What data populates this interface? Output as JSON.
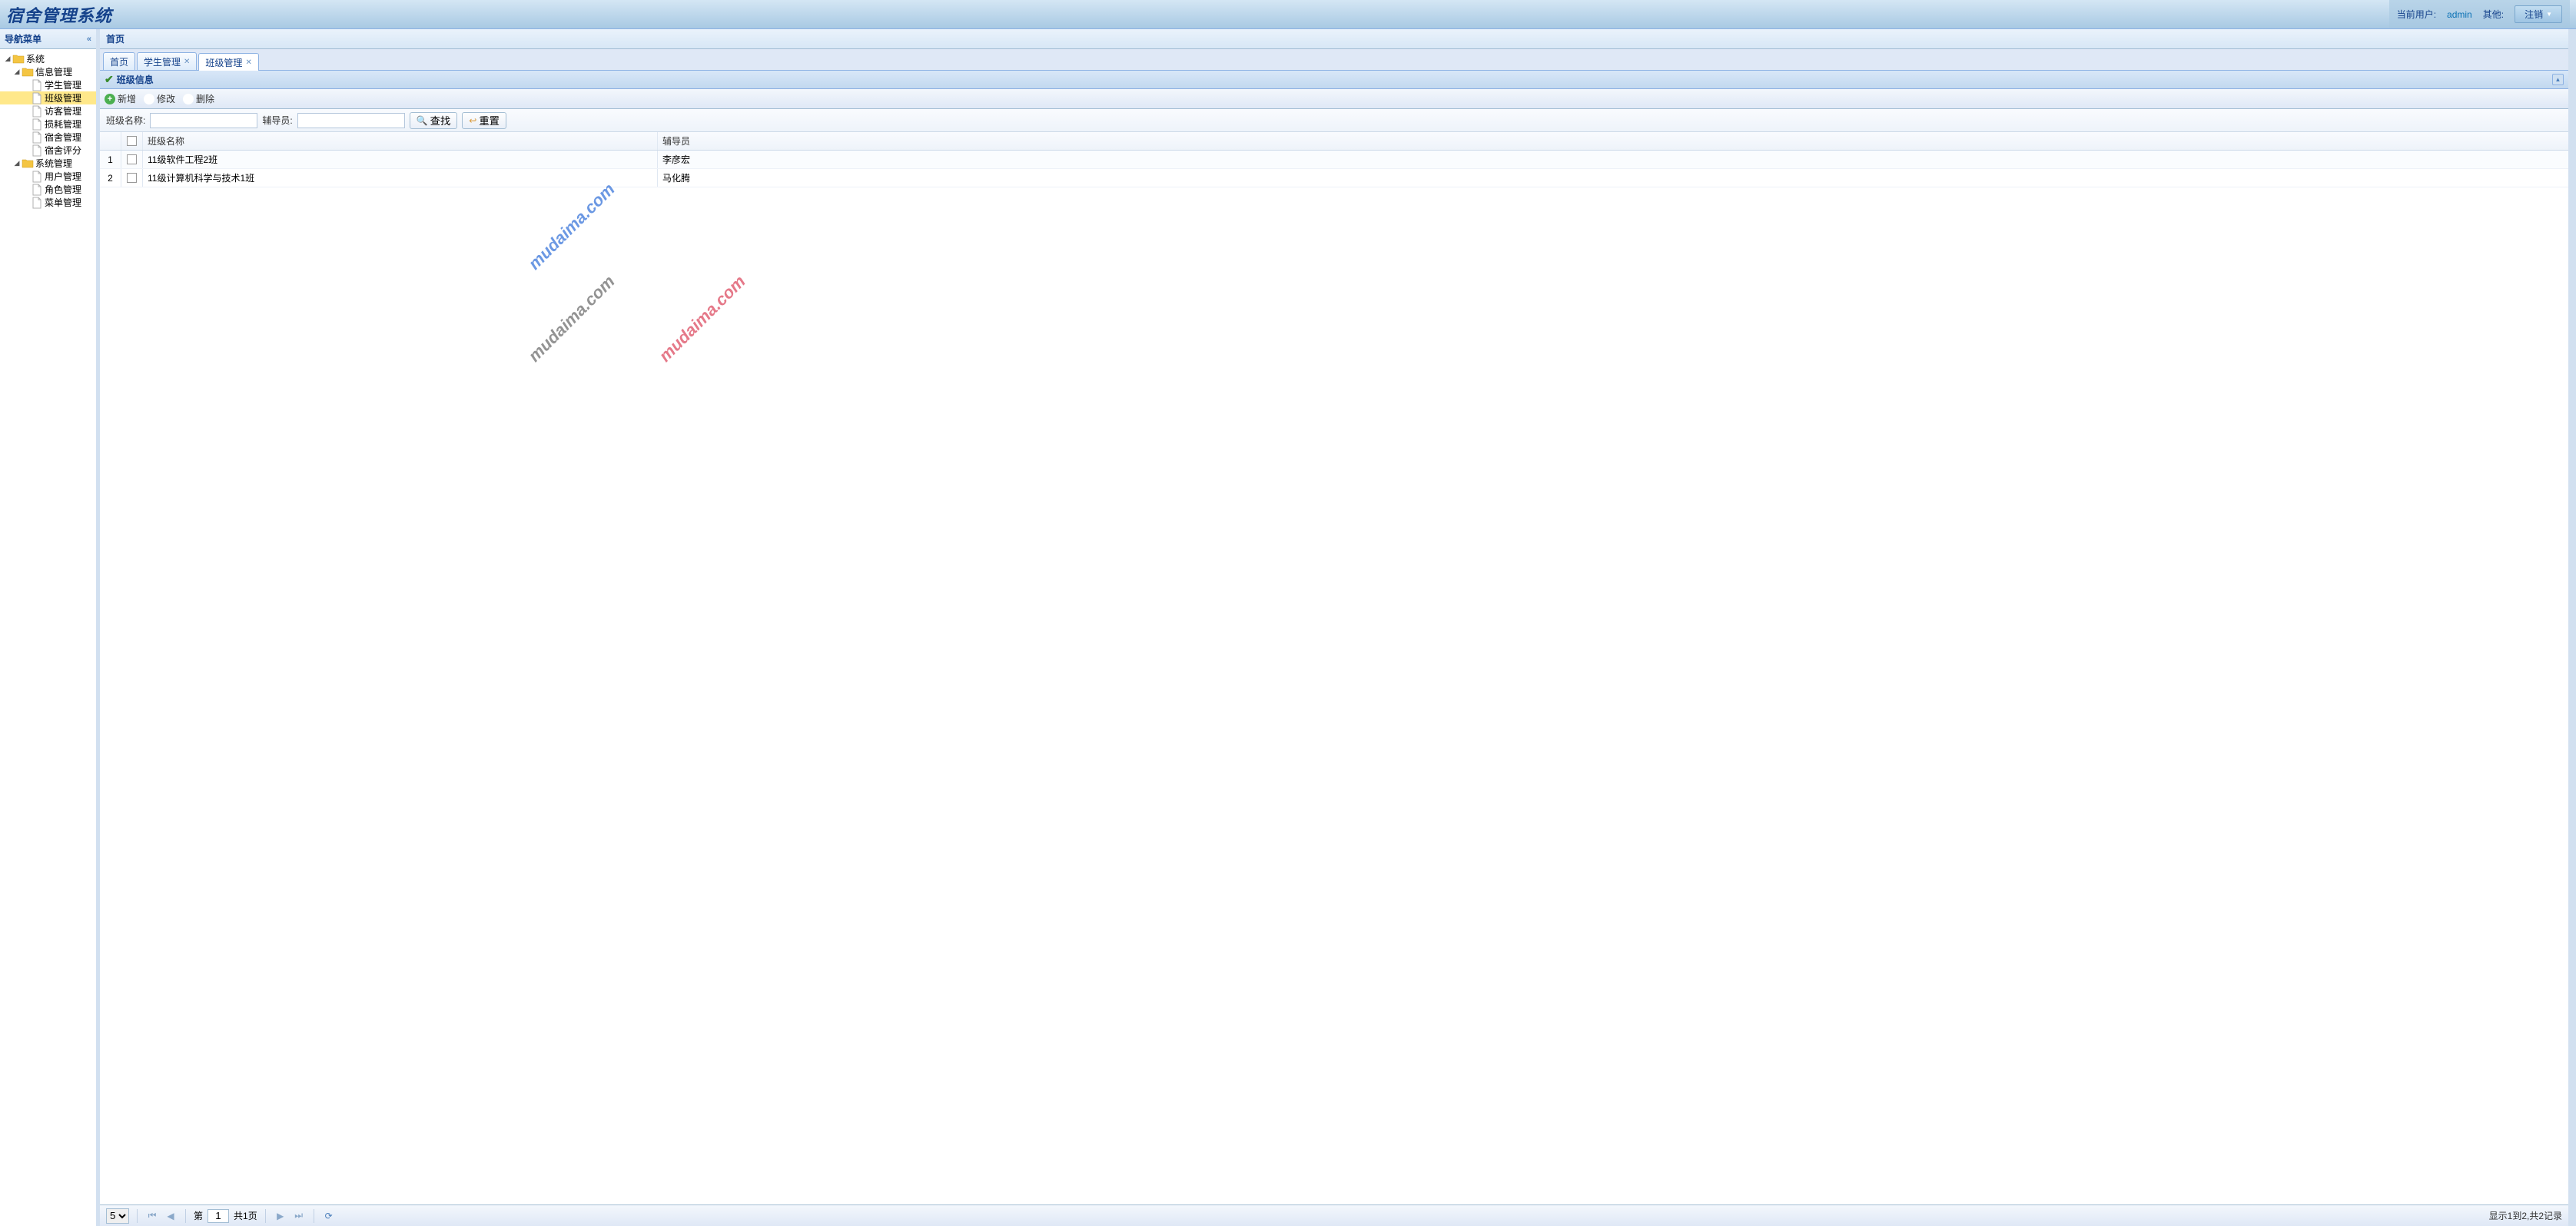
{
  "header": {
    "logo": "宿舍管理系统",
    "current_user_label": "当前用户:",
    "current_user": "admin",
    "other_label": "其他:",
    "logout_label": "注销"
  },
  "sidebar": {
    "title": "导航菜单",
    "nodes": [
      {
        "label": "系统",
        "type": "folder",
        "depth": 0,
        "expanded": true
      },
      {
        "label": "信息管理",
        "type": "folder",
        "depth": 1,
        "expanded": true
      },
      {
        "label": "学生管理",
        "type": "page",
        "depth": 2
      },
      {
        "label": "班级管理",
        "type": "page",
        "depth": 2,
        "selected": true
      },
      {
        "label": "访客管理",
        "type": "page",
        "depth": 2
      },
      {
        "label": "损耗管理",
        "type": "page",
        "depth": 2
      },
      {
        "label": "宿舍管理",
        "type": "page",
        "depth": 2
      },
      {
        "label": "宿舍评分",
        "type": "page",
        "depth": 2
      },
      {
        "label": "系统管理",
        "type": "folder",
        "depth": 1,
        "expanded": true
      },
      {
        "label": "用户管理",
        "type": "page",
        "depth": 2
      },
      {
        "label": "角色管理",
        "type": "page",
        "depth": 2
      },
      {
        "label": "菜单管理",
        "type": "page",
        "depth": 2
      }
    ]
  },
  "content": {
    "title": "首页",
    "tabs": [
      {
        "label": "首页",
        "closable": false,
        "active": false
      },
      {
        "label": "学生管理",
        "closable": true,
        "active": false
      },
      {
        "label": "班级管理",
        "closable": true,
        "active": true
      }
    ],
    "panel_title": "班级信息",
    "toolbar": {
      "add": "新增",
      "edit": "修改",
      "del": "删除"
    },
    "search": {
      "name_label": "班级名称:",
      "name_value": "",
      "coach_label": "辅导员:",
      "coach_value": "",
      "find_label": "查找",
      "reset_label": "重置"
    },
    "grid": {
      "columns": {
        "name": "班级名称",
        "coach": "辅导员"
      },
      "rows": [
        {
          "num": "1",
          "name": "11级软件工程2班",
          "coach": "李彦宏"
        },
        {
          "num": "2",
          "name": "11级计算机科学与技术1班",
          "coach": "马化腾"
        }
      ]
    },
    "pager": {
      "page_size": "5",
      "page_label_prefix": "第",
      "page_value": "1",
      "page_total": "共1页",
      "info": "显示1到2,共2记录"
    },
    "watermark": "mudaima.com"
  }
}
